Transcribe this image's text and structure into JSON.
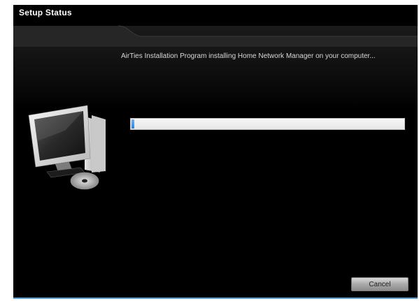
{
  "window": {
    "title": "Setup Status"
  },
  "main": {
    "status_message": "AirTies Installation Program installing Home Network Manager on your computer...",
    "progress": 0.01
  },
  "footer": {
    "cancel_label": "Cancel"
  },
  "icons": {
    "illustration": "computer-with-disc-icon"
  },
  "colors": {
    "background": "#000000",
    "progress_fill": "#2e7fd8",
    "progress_track": "#eeeeee"
  }
}
